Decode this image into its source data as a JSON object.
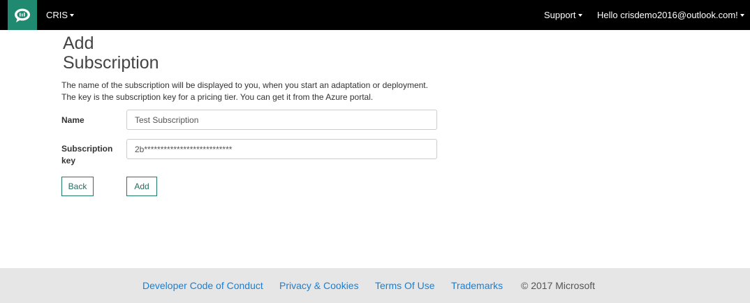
{
  "navbar": {
    "logo_icon": "speech-bubble-icon",
    "brand": "CRIS",
    "support": "Support",
    "user": "Hello crisdemo2016@outlook.com!",
    "background": "#000000",
    "accent": "#1f8a70"
  },
  "page": {
    "title_line1": "Add",
    "title_line2": "Subscription",
    "desc_line1": "The name of the subscription will be displayed to you, when you start an adaptation or deployment.",
    "desc_line2": "The key is the subscription key for a pricing tier. You can get it from the Azure portal."
  },
  "form": {
    "name_label": "Name",
    "name_value": "Test Subscription",
    "key_label_line1": "Subscription",
    "key_label_line2": "key",
    "key_value": "2b***************************",
    "back_label": "Back",
    "add_label": "Add"
  },
  "footer": {
    "links": [
      "Developer Code of Conduct",
      "Privacy & Cookies",
      "Terms Of Use",
      "Trademarks"
    ],
    "copyright": "© 2017 Microsoft",
    "link_color": "#1a7fd4"
  }
}
